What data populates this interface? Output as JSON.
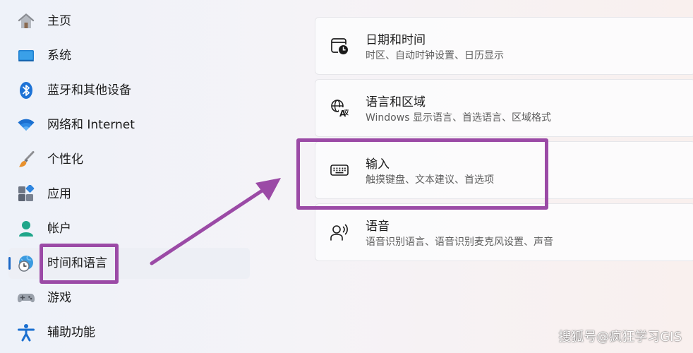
{
  "sidebar": {
    "items": [
      {
        "label": "主页",
        "icon": "home-icon"
      },
      {
        "label": "系统",
        "icon": "monitor-icon"
      },
      {
        "label": "蓝牙和其他设备",
        "icon": "bluetooth-icon"
      },
      {
        "label": "网络和 Internet",
        "icon": "wifi-icon"
      },
      {
        "label": "个性化",
        "icon": "paintbrush-icon"
      },
      {
        "label": "应用",
        "icon": "apps-icon"
      },
      {
        "label": "帐户",
        "icon": "person-icon"
      },
      {
        "label": "时间和语言",
        "icon": "globe-clock-icon",
        "selected": true
      },
      {
        "label": "游戏",
        "icon": "gamepad-icon"
      },
      {
        "label": "辅助功能",
        "icon": "accessibility-icon"
      }
    ]
  },
  "cards": [
    {
      "title": "日期和时间",
      "description": "时区、自动时钟设置、日历显示",
      "icon": "calendar-clock-icon"
    },
    {
      "title": "语言和区域",
      "description": "Windows 显示语言、首选语言、区域格式",
      "icon": "language-icon"
    },
    {
      "title": "输入",
      "description": "触摸键盘、文本建议、首选项",
      "icon": "keyboard-icon"
    },
    {
      "title": "语音",
      "description": "语音识别语言、语音识别麦克风设置、声音",
      "icon": "speech-icon"
    }
  ],
  "watermark": "搜狐号@疯狂学习GIS",
  "colors": {
    "annotation": "#9b4aa6",
    "accent": "#1a67c6"
  }
}
